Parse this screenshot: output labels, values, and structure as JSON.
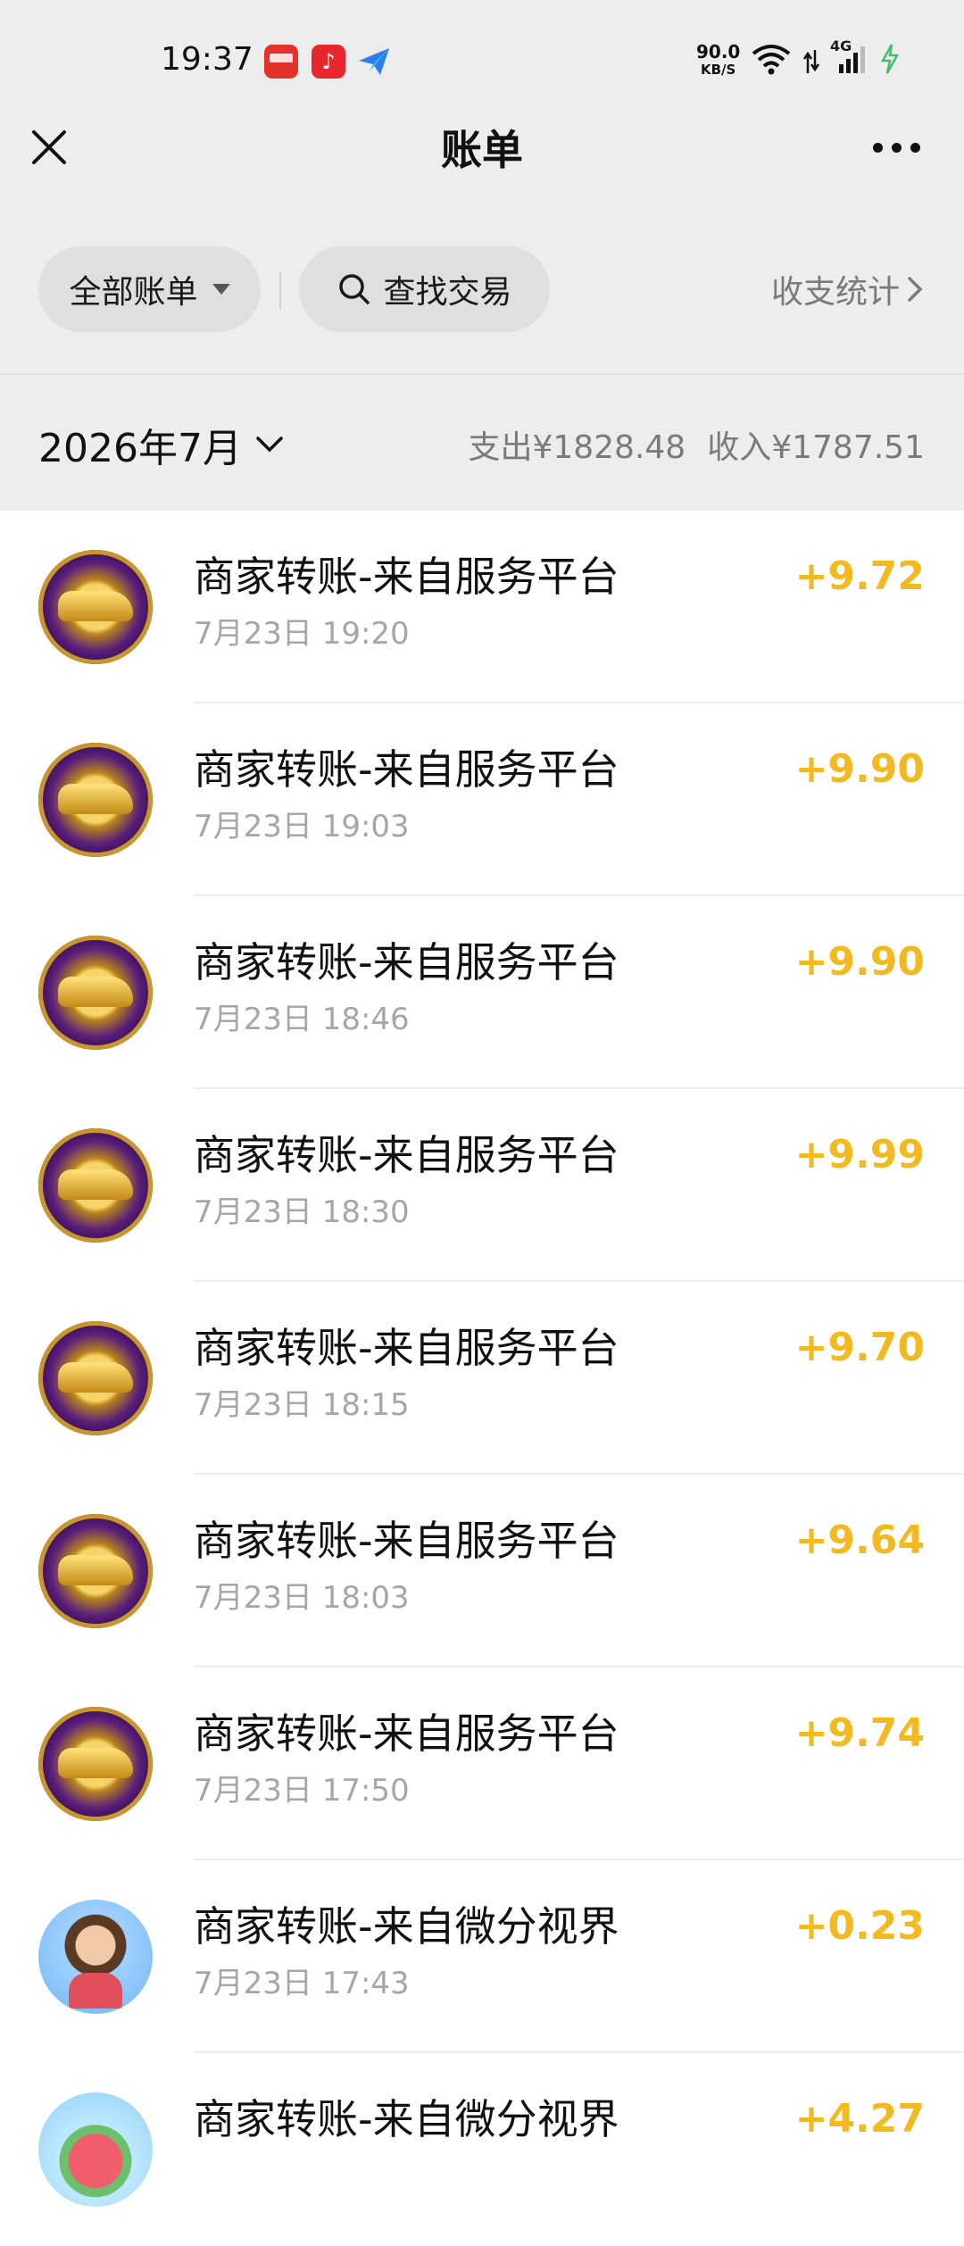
{
  "status_bar": {
    "time": "19:37",
    "app_icons": [
      "xiaohongshu-app-icon",
      "music-app-icon",
      "feishu-app-icon"
    ],
    "netspeed_value": "90.0",
    "netspeed_unit": "KB/S",
    "network_label": "4G"
  },
  "nav": {
    "title": "账单"
  },
  "filters": {
    "all_bills_label": "全部账单",
    "search_label": "查找交易",
    "stats_label": "收支统计"
  },
  "month_bar": {
    "month": "2026年7月",
    "expense": "支出¥1828.48",
    "income": "收入¥1787.51"
  },
  "transactions": [
    {
      "title": "商家转账-来自服务平台",
      "time": "7月23日 19:20",
      "amount": "+9.72",
      "avatar": "gold-car-avatar"
    },
    {
      "title": "商家转账-来自服务平台",
      "time": "7月23日 19:03",
      "amount": "+9.90",
      "avatar": "gold-car-avatar"
    },
    {
      "title": "商家转账-来自服务平台",
      "time": "7月23日 18:46",
      "amount": "+9.90",
      "avatar": "gold-car-avatar"
    },
    {
      "title": "商家转账-来自服务平台",
      "time": "7月23日 18:30",
      "amount": "+9.99",
      "avatar": "gold-car-avatar"
    },
    {
      "title": "商家转账-来自服务平台",
      "time": "7月23日 18:15",
      "amount": "+9.70",
      "avatar": "gold-car-avatar"
    },
    {
      "title": "商家转账-来自服务平台",
      "time": "7月23日 18:03",
      "amount": "+9.64",
      "avatar": "gold-car-avatar"
    },
    {
      "title": "商家转账-来自服务平台",
      "time": "7月23日 17:50",
      "amount": "+9.74",
      "avatar": "gold-car-avatar"
    },
    {
      "title": "商家转账-来自微分视界",
      "time": "7月23日 17:43",
      "amount": "+0.23",
      "avatar": "girl-reading-avatar"
    },
    {
      "title": "商家转账-来自微分视界",
      "time": "",
      "amount": "+4.27",
      "avatar": "watermelon-avatar"
    }
  ],
  "colors": {
    "income_amount": "#f2b920",
    "header_bg": "#ededed",
    "secondary_text": "#7a7a7a"
  }
}
